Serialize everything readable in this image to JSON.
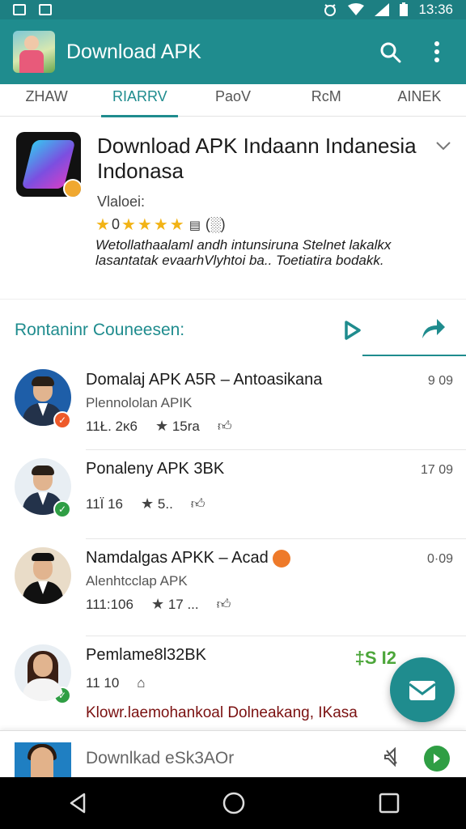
{
  "status_bar": {
    "time": "13:36"
  },
  "app_bar": {
    "title": "Download APK"
  },
  "tabs": [
    {
      "label": "ZHAW"
    },
    {
      "label": "RIARRV"
    },
    {
      "label": "PaoV"
    },
    {
      "label": "RcM"
    },
    {
      "label": "AINEK"
    }
  ],
  "app_card": {
    "name": "Download APK Indaann Indanesia Indonasa",
    "vendor": "Vlaloei:",
    "rating_prefix": "0",
    "rating_count": "(░)",
    "description": "Wetollathaalaml andh intunsiruna Stelnet lakalkx lasantatak evaarhVlyhtoi ba.. Toetiatira bodakk."
  },
  "section": {
    "title": "Rontaninr Couneesen:"
  },
  "list": [
    {
      "name": "Domalaj APK A5R – Antoasikana",
      "sub": "Plennololan APIK",
      "num": "11Ł. 2ĸ6",
      "rating": "15ra",
      "time": "9 09",
      "status": "orange"
    },
    {
      "name": "Ponaleny APK 3BK",
      "sub": "",
      "num": "11Ї  16",
      "rating": "5..",
      "time": "17 09",
      "status": "green"
    },
    {
      "name": "Namdalgas APKK – Acad",
      "sub": "Alenhtcclap APK",
      "num": "111:106",
      "rating": "17 ...",
      "time": "0·09",
      "status": "none"
    },
    {
      "name": "Pemlame8l32BK",
      "sub": "",
      "num": "11  10",
      "rating": "",
      "time": "",
      "tag": "‡S I2",
      "alert": "Klowr.laemohankoal Dolneakang, IKasa",
      "status": "green"
    }
  ],
  "bottom_card": {
    "title": "Downlkad eSk3AOr"
  },
  "colors": {
    "primary": "#1f8c8e",
    "status_bar": "#1d7f82",
    "star": "#f2b316",
    "accent_green": "#2f9e44",
    "accent_orange": "#ee5a2a"
  }
}
